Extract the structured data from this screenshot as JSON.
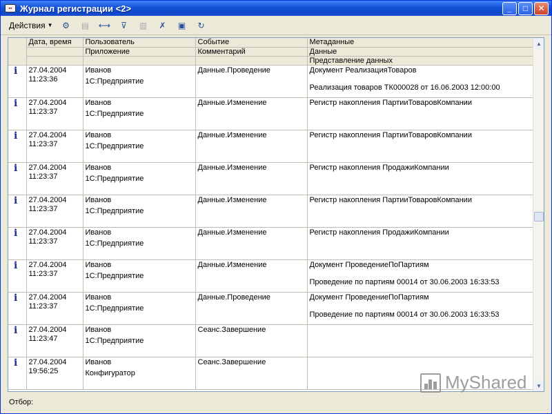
{
  "window": {
    "title": "Журнал регистрации <2>"
  },
  "toolbar": {
    "actions_label": "Действия"
  },
  "columns": {
    "row1": [
      "Дата, время",
      "Пользователь",
      "Событие",
      "Метаданные"
    ],
    "row2": [
      "",
      "Приложение",
      "Комментарий",
      "Данные"
    ],
    "row3": [
      "",
      "",
      "",
      "Представление данных"
    ]
  },
  "rows": [
    {
      "date": "27.04.2004",
      "time": "11:23:36",
      "user": "Иванов",
      "app": "1С:Предприятие",
      "event": "Данные.Проведение",
      "meta": "Документ РеализацияТоваров",
      "data_repr": "Реализация товаров ТК000028 от 16.06.2003 12:00:00"
    },
    {
      "date": "27.04.2004",
      "time": "11:23:37",
      "user": "Иванов",
      "app": "1С:Предприятие",
      "event": "Данные.Изменение",
      "meta": "Регистр накопления ПартииТоваровКомпании",
      "data_repr": ""
    },
    {
      "date": "27.04.2004",
      "time": "11:23:37",
      "user": "Иванов",
      "app": "1С:Предприятие",
      "event": "Данные.Изменение",
      "meta": "Регистр накопления ПартииТоваровКомпании",
      "data_repr": ""
    },
    {
      "date": "27.04.2004",
      "time": "11:23:37",
      "user": "Иванов",
      "app": "1С:Предприятие",
      "event": "Данные.Изменение",
      "meta": "Регистр накопления ПродажиКомпании",
      "data_repr": ""
    },
    {
      "date": "27.04.2004",
      "time": "11:23:37",
      "user": "Иванов",
      "app": "1С:Предприятие",
      "event": "Данные.Изменение",
      "meta": "Регистр накопления ПартииТоваровКомпании",
      "data_repr": ""
    },
    {
      "date": "27.04.2004",
      "time": "11:23:37",
      "user": "Иванов",
      "app": "1С:Предприятие",
      "event": "Данные.Изменение",
      "meta": "Регистр накопления ПродажиКомпании",
      "data_repr": ""
    },
    {
      "date": "27.04.2004",
      "time": "11:23:37",
      "user": "Иванов",
      "app": "1С:Предприятие",
      "event": "Данные.Изменение",
      "meta": "Документ ПроведениеПоПартиям",
      "data_repr": "Проведение по партиям 00014 от 30.06.2003 16:33:53"
    },
    {
      "date": "27.04.2004",
      "time": "11:23:37",
      "user": "Иванов",
      "app": "1С:Предприятие",
      "event": "Данные.Проведение",
      "meta": "Документ ПроведениеПоПартиям",
      "data_repr": "Проведение по партиям 00014 от 30.06.2003 16:33:53"
    },
    {
      "date": "27.04.2004",
      "time": "11:23:47",
      "user": "Иванов",
      "app": "1С:Предприятие",
      "event": "Сеанс.Завершение",
      "meta": "",
      "data_repr": ""
    },
    {
      "date": "27.04.2004",
      "time": "19:56:25",
      "user": "Иванов",
      "app": "Конфигуратор",
      "event": "Сеанс.Завершение",
      "meta": "",
      "data_repr": ""
    }
  ],
  "filter": {
    "label": "Отбор:"
  },
  "watermark": {
    "text": "MyShared"
  },
  "icons": {
    "row_icon": "info-icon"
  }
}
